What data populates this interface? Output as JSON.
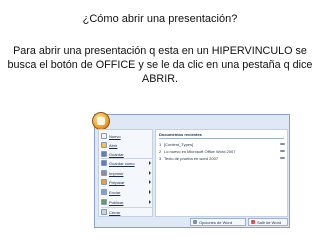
{
  "slide": {
    "title": "¿Cómo abrir una presentación?",
    "body": "Para abrir una presentación q esta en un HIPERVINCULO se busca el botón de OFFICE y se le da clic en una pestaña q dice ABRIR."
  },
  "office_menu": {
    "commands": [
      {
        "label": "Nuevo",
        "icon": "new-document-icon",
        "color": "#f5f5f5",
        "has_arrow": false
      },
      {
        "label": "Abrir",
        "icon": "open-folder-icon",
        "color": "#f2c24e",
        "has_arrow": false
      },
      {
        "label": "Guardar",
        "icon": "save-disk-icon",
        "color": "#5b7fc4",
        "has_arrow": false
      },
      {
        "label": "Guardar como",
        "icon": "save-as-icon",
        "color": "#5b7fc4",
        "has_arrow": true
      },
      {
        "label": "Imprimir",
        "icon": "printer-icon",
        "color": "#8a8f99",
        "has_arrow": true
      },
      {
        "label": "Preparar",
        "icon": "prepare-icon",
        "color": "#e8a23a",
        "has_arrow": true
      },
      {
        "label": "Enviar",
        "icon": "send-icon",
        "color": "#7ea0d4",
        "has_arrow": true
      },
      {
        "label": "Publicar",
        "icon": "publish-icon",
        "color": "#6a9a5a",
        "has_arrow": true
      },
      {
        "label": "Cerrar",
        "icon": "close-document-icon",
        "color": "#c9d3e3",
        "has_arrow": false
      }
    ],
    "recent": {
      "heading": "Documentos recientes",
      "items": [
        {
          "num": "1",
          "name": "[Content_Types]"
        },
        {
          "num": "2",
          "name": "Lo nuevo en Microsoft Office Word 2007"
        },
        {
          "num": "3",
          "name": "Texto de prueba en word 2007"
        }
      ]
    },
    "options_label": "Opciones de Word",
    "exit_label": "Salir de Word",
    "accent": "#f2a531"
  }
}
